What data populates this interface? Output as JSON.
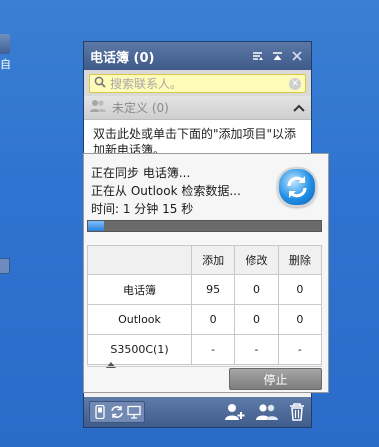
{
  "desktop": {
    "label": "自"
  },
  "phonebook": {
    "title": "电话簿 (0)",
    "search_placeholder": "搜索联系人。",
    "group_label": "未定义 (0)",
    "hint": "双击此处或单击下面的\"添加项目\"以添加新电话簿。"
  },
  "sync": {
    "line1": "正在同步 电话簿...",
    "line2": "正在从 Outlook 检索数据...",
    "line3": "时间: 1 分钟 15 秒",
    "progress": 0.07,
    "table": {
      "headers": [
        "",
        "添加",
        "修改",
        "删除"
      ],
      "rows": [
        [
          "电话簿",
          "95",
          "0",
          "0"
        ],
        [
          "Outlook",
          "0",
          "0",
          "0"
        ],
        [
          "S3500C(1)",
          "-",
          "-",
          "-"
        ]
      ]
    },
    "stop_label": "停止"
  },
  "colors": {
    "title_bar": "#4a679a",
    "search_bg": "#fffbb8",
    "accent": "#1f8ee6"
  }
}
